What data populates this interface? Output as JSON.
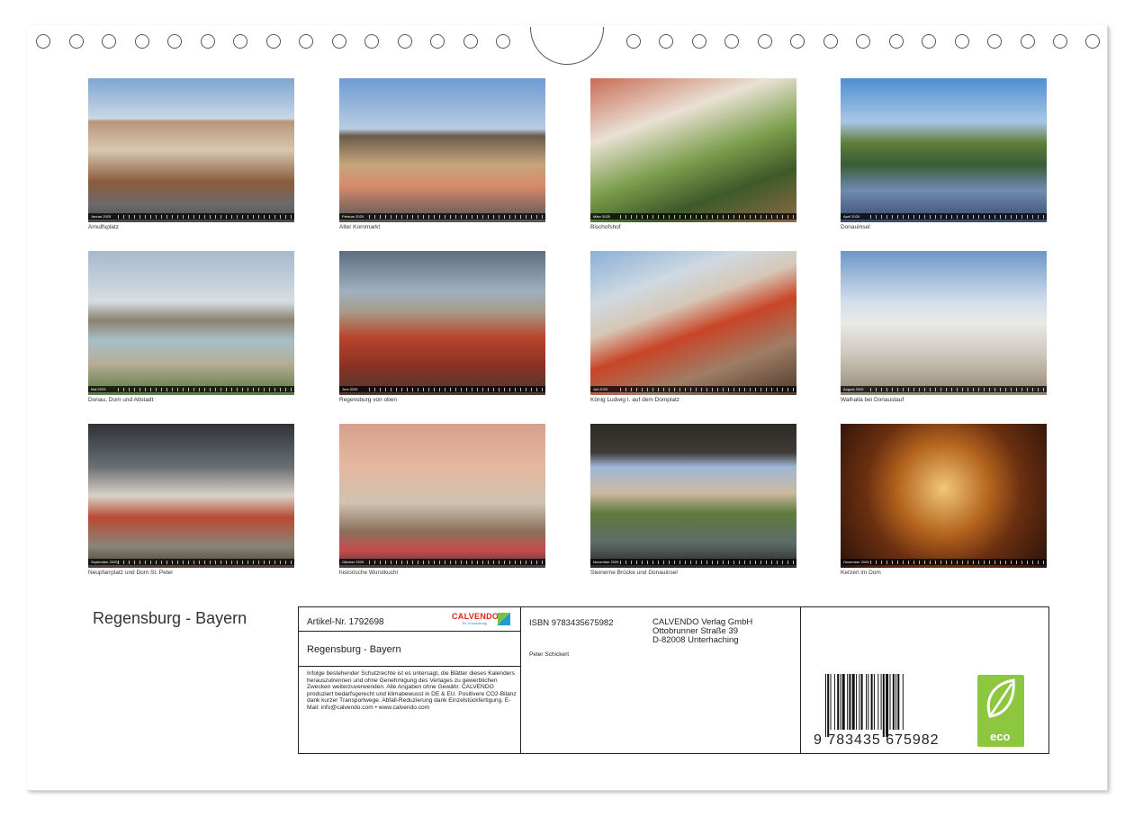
{
  "title": "Regensburg - Bayern",
  "photos": [
    {
      "caption": "Arnulfsplatz",
      "month": "Januar 2025"
    },
    {
      "caption": "Alter Kornmarkt",
      "month": "Februar 2025"
    },
    {
      "caption": "Bischofshof",
      "month": "März 2025"
    },
    {
      "caption": "Donauinsel",
      "month": "April 2025"
    },
    {
      "caption": "Donau, Dom und Altstadt",
      "month": "Mai 2025"
    },
    {
      "caption": "Regensburg von oben",
      "month": "Juni 2025"
    },
    {
      "caption": "König Ludwig I. auf dem Domplatz",
      "month": "Juli 2025"
    },
    {
      "caption": "Walhalla bei Donaustauf",
      "month": "August 2025"
    },
    {
      "caption": "Neupfarrplatz und Dom St. Peter",
      "month": "September 2025"
    },
    {
      "caption": "historische Wurstkuchl",
      "month": "Oktober 2025"
    },
    {
      "caption": "Steinerne Brücke und Donauinsel",
      "month": "November 2025"
    },
    {
      "caption": "Kerzen im Dom",
      "month": "Dezember 2025"
    }
  ],
  "info": {
    "article": "Artikel-Nr. 1792698",
    "logo": "CALVENDO",
    "logo_sub": "Ihr Kunstverlag",
    "subtitle": "Regensburg - Bayern",
    "legal": "Infolge bestehender Schutzrechte ist es untersagt, die Blätter dieses Kalenders herauszutrennen und ohne Genehmigung des Verlages zu gewerblichen Zwecken weiterzuverwenden. Alle Angaben ohne Gewähr. CALVENDO produziert bedarfsgerecht und klimabewusst in DE & EU. Positivere CO2-Bilanz dank kurzer Transportwege. Abfall-Reduzierung dank Einzelstückfertigung. E-Mail: info@calvendo.com • www.calvendo.com",
    "isbn": "ISBN 9783435675982",
    "publisher_line1": "CALVENDO Verlag GmbH",
    "publisher_line2": "Ottobrunner Straße 39",
    "publisher_line3": "D-82008 Unterhaching",
    "author": "Peter Schickert",
    "barcode_number": "9 783435 675982",
    "eco_label": "eco"
  },
  "colors": {
    "eco_green": "#8dc63f",
    "calvendo_red": "#e2231a",
    "calvendo_blue": "#3a86c8"
  }
}
